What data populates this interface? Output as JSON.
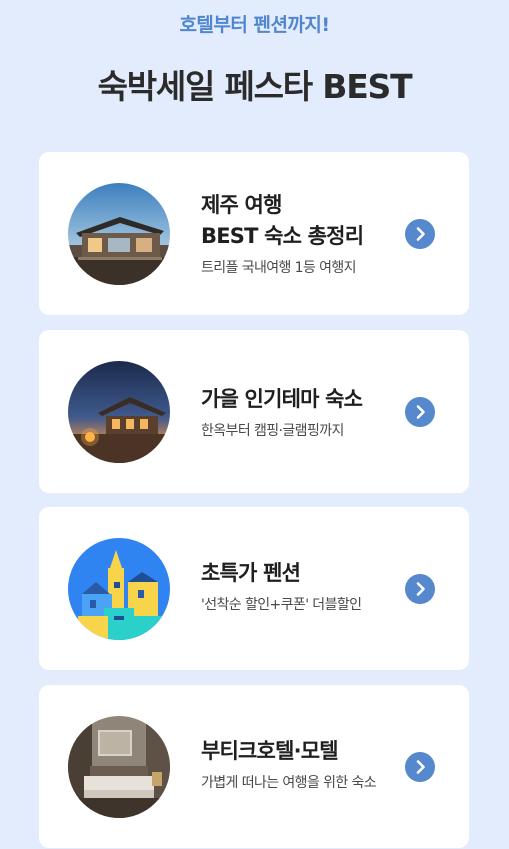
{
  "header": {
    "subtitle": "호텔부터 펜션까지!",
    "title": "숙박세일 페스타 BEST"
  },
  "cards": [
    {
      "title_lines": [
        "제주 여행",
        "BEST 숙소 총정리"
      ],
      "subtitle": "트리플 국내여행 1등 여행지",
      "image_icon": "jeju-modern-house-image",
      "arrow_icon": "chevron-right-icon"
    },
    {
      "title_lines": [
        "가을 인기테마 숙소"
      ],
      "subtitle": "한옥부터 캠핑·글램핑까지",
      "image_icon": "hanok-night-image",
      "arrow_icon": "chevron-right-icon"
    },
    {
      "title_lines": [
        "초특가 펜션"
      ],
      "subtitle": "'선착순 할인+쿠폰' 더블할인",
      "image_icon": "pension-illustration-image",
      "arrow_icon": "chevron-right-icon"
    },
    {
      "title_lines": [
        "부티크호텔·모텔"
      ],
      "subtitle": "가볍게 떠나는 여행을 위한 숙소",
      "image_icon": "boutique-hotel-room-image",
      "arrow_icon": "chevron-right-icon"
    }
  ],
  "colors": {
    "background": "#e2ecfc",
    "accent": "#4f86cf",
    "button": "#5588cc",
    "card": "#ffffff"
  }
}
